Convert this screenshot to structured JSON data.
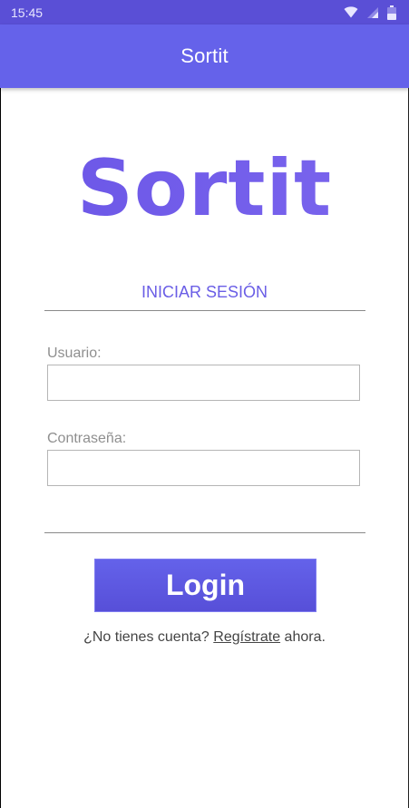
{
  "status_bar": {
    "time": "15:45",
    "icons": [
      "wifi-icon",
      "signal-icon",
      "battery-icon"
    ]
  },
  "app_bar": {
    "title": "Sortit"
  },
  "logo": {
    "text": "Sortit"
  },
  "login_form": {
    "section_title": "INICIAR SESIÓN",
    "username": {
      "label": "Usuario:",
      "value": "",
      "placeholder": ""
    },
    "password": {
      "label": "Contraseña:",
      "value": "",
      "placeholder": ""
    },
    "login_label": "Login"
  },
  "register": {
    "prefix": "¿No tienes cuenta? ",
    "link": "Regístrate",
    "suffix": " ahora."
  },
  "colors": {
    "status_bar": "#5a4fd6",
    "app_bar": "#6562ea",
    "accent": "#6a5ee6",
    "logo": "#6f59e8"
  }
}
